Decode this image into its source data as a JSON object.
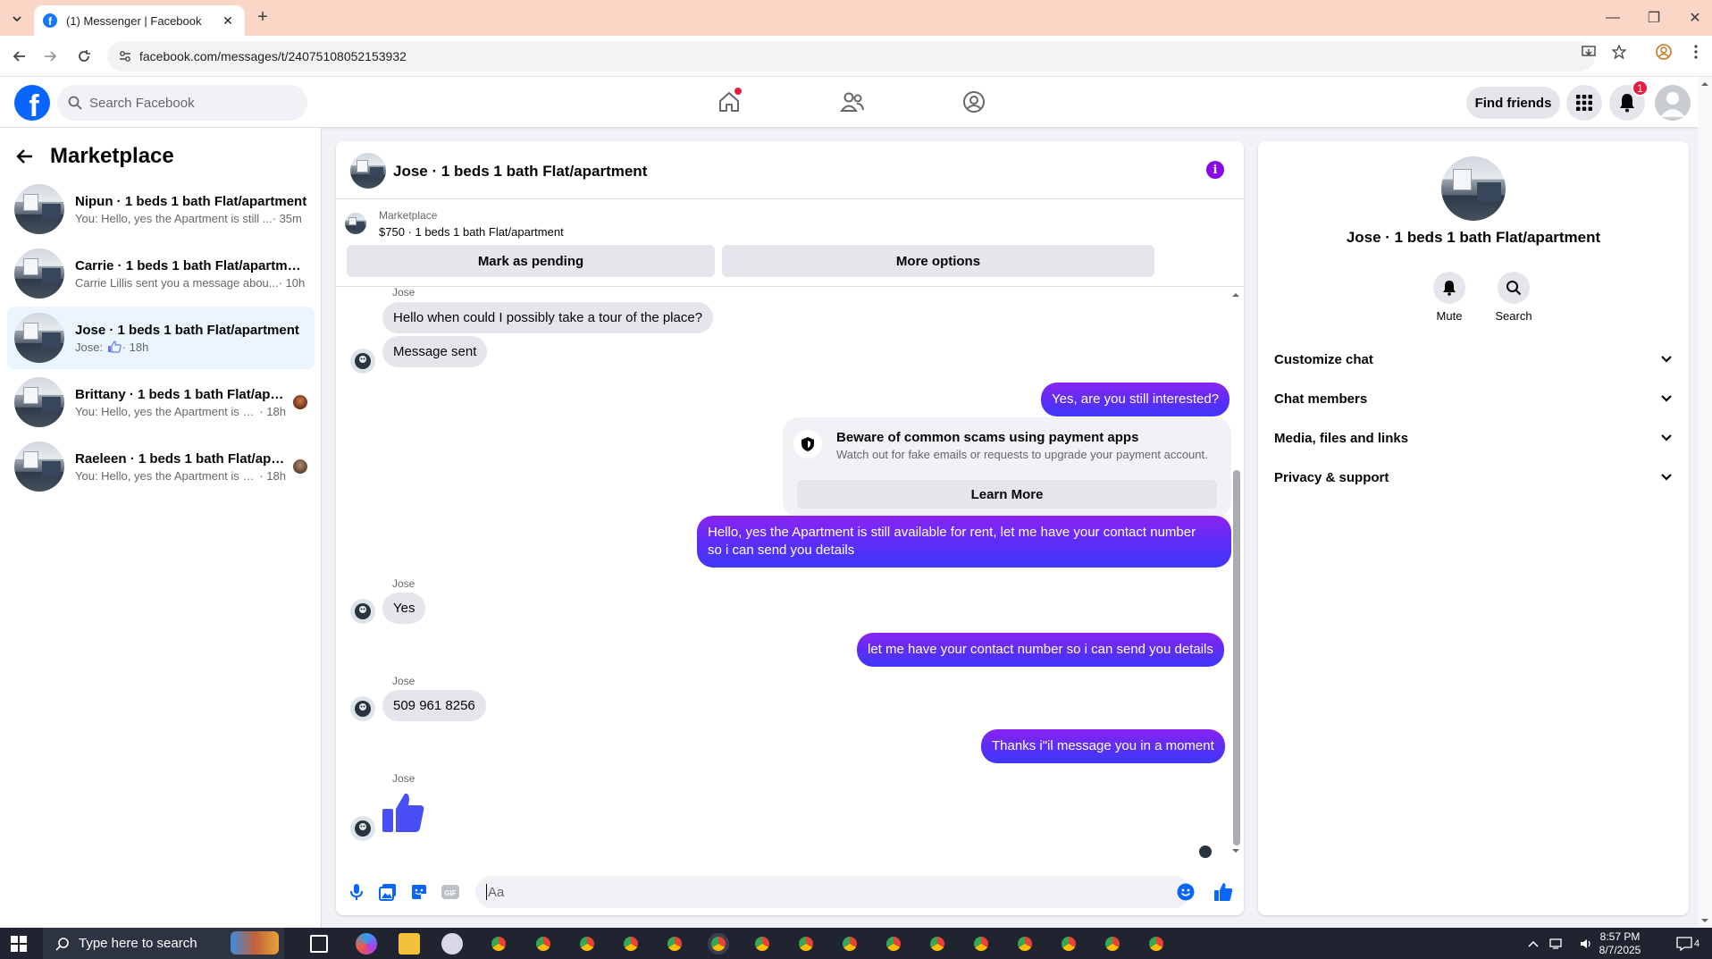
{
  "browser": {
    "tab_title": "(1) Messenger | Facebook",
    "url": "facebook.com/messages/t/24075108052153932"
  },
  "fb_header": {
    "search_placeholder": "Search Facebook",
    "find_friends_label": "Find friends",
    "notification_count": "1"
  },
  "sidebar": {
    "title": "Marketplace",
    "conversations": [
      {
        "name": "Nipun · 1 beds 1 bath Flat/apartment",
        "snippet": "You: Hello, yes the Apartment is still ...",
        "time": " · 35m",
        "active": false
      },
      {
        "name": "Carrie · 1 beds 1 bath Flat/apartment",
        "snippet": "Carrie Lillis sent you a message abou...",
        "time": " · 10h",
        "active": false
      },
      {
        "name": "Jose · 1 beds 1 bath Flat/apartment",
        "snippet": "Jose: ",
        "time": " · 18h",
        "active": true
      },
      {
        "name": "Brittany · 1 beds 1 bath Flat/apar...",
        "snippet": "You: Hello, yes the Apartment is st...",
        "time": " · 18h",
        "active": false
      },
      {
        "name": "Raeleen · 1 beds 1 bath Flat/apar...",
        "snippet": "You: Hello, yes the Apartment is st...",
        "time": " · 18h",
        "active": false
      }
    ]
  },
  "chat": {
    "title": "Jose · 1 beds 1 bath Flat/apartment",
    "listing_label": "Marketplace",
    "listing_price": "$750 · 1 beds 1 bath Flat/apartment",
    "mark_pending_label": "Mark as pending",
    "more_options_label": "More options",
    "sender_name": "Jose",
    "messages": {
      "m1": "Hello when could I possibly take a tour of the place?",
      "m2": "Message sent",
      "m3": "Yes, are you still interested?",
      "m4_line1": "Hello, yes the Apartment is still available for rent, let me have your contact number",
      "m4_line2": "so i can send you details",
      "m5": "Yes",
      "m6": "let me have your contact number so i can send you details",
      "m7": "509 961 8256",
      "m8": "Thanks i\"il message you in a moment"
    },
    "scam_notice": {
      "heading": "Beware of common scams using payment apps",
      "body": "Watch out for fake emails or requests to upgrade your payment account.",
      "learn_more": "Learn More"
    },
    "composer_placeholder": "Aa"
  },
  "right_panel": {
    "title": "Jose · 1 beds 1 bath Flat/apartment",
    "mute_label": "Mute",
    "search_label": "Search",
    "rows": [
      "Customize chat",
      "Chat members",
      "Media, files and links",
      "Privacy & support"
    ]
  },
  "taskbar": {
    "search_placeholder": "Type here to search",
    "time": "8:57 PM",
    "date": "8/7/2025",
    "notification_count": "4"
  },
  "colors": {
    "fb_blue": "#0866ff",
    "outgoing_bubble": "#5b2ef7",
    "incoming_bubble": "#e4e6eb",
    "notification_red": "#e41e3f"
  }
}
